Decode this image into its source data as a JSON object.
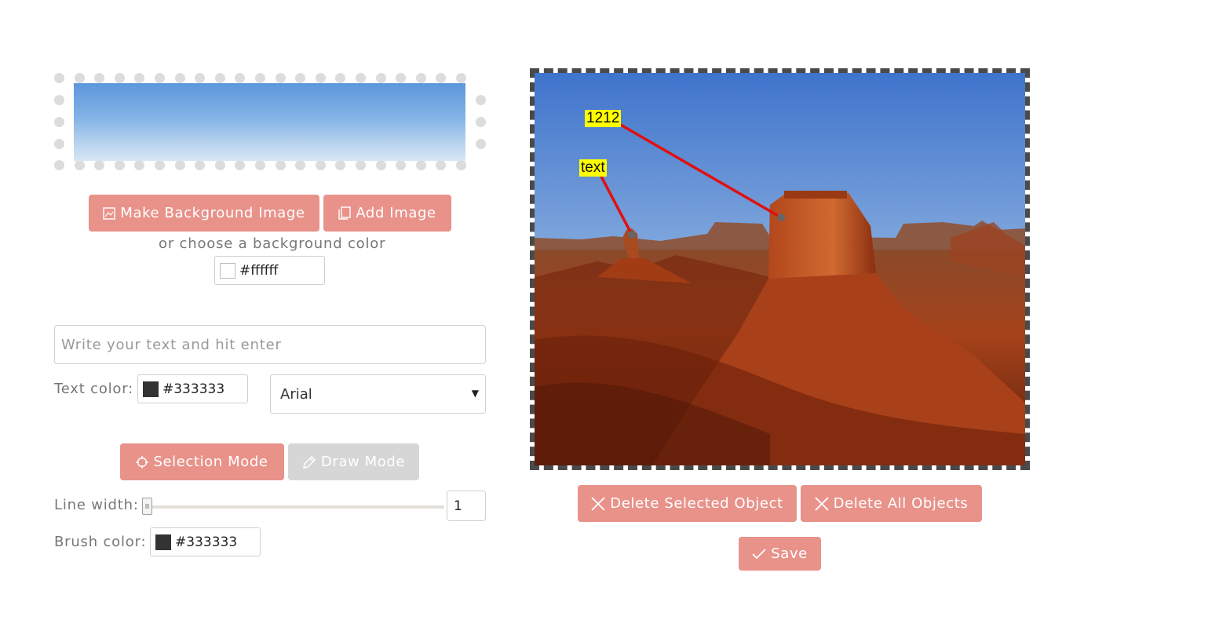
{
  "toolbar": {
    "make_background_label": "Make Background Image",
    "add_image_label": "Add Image",
    "background_color_hint": "or choose a background color",
    "background_color_value": "#ffffff"
  },
  "text_tool": {
    "placeholder": "Write your text and hit enter",
    "text_color_label": "Text color:",
    "text_color_value": "#333333",
    "font_selected": "Arial"
  },
  "mode": {
    "selection_label": "Selection Mode",
    "draw_label": "Draw Mode",
    "active": "selection"
  },
  "brush": {
    "line_width_label": "Line width:",
    "line_width_value": "1",
    "brush_color_label": "Brush color:",
    "brush_color_value": "#333333"
  },
  "canvas": {
    "annotations": [
      {
        "text": "1212"
      },
      {
        "text": "text"
      }
    ]
  },
  "actions": {
    "delete_selected_label": "Delete Selected Object",
    "delete_all_label": "Delete All Objects",
    "save_label": "Save"
  },
  "colors": {
    "accent": "#e8928a",
    "disabled": "#d6d6d6",
    "annotation_bg": "#ffff00",
    "annotation_line": "#e01010"
  }
}
